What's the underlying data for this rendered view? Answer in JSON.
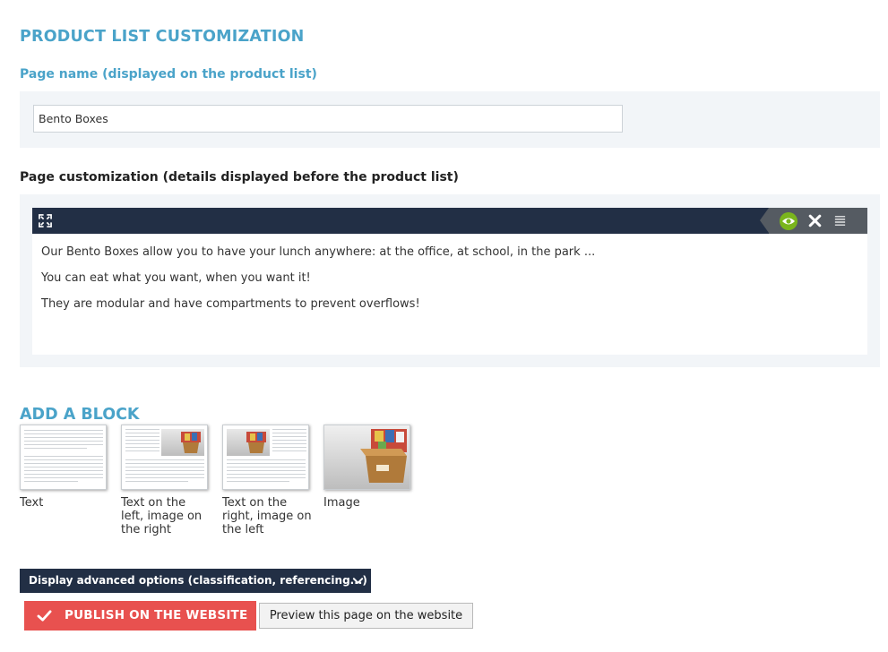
{
  "page": {
    "main_title": "PRODUCT LIST CUSTOMIZATION",
    "page_name_label": "Page name (displayed on the product list)",
    "page_name_value": "Bento Boxes",
    "customization_label": "Page customization (details displayed before the product list)"
  },
  "editor": {
    "toolbar_icons": [
      "expand-icon",
      "eye-icon",
      "close-icon",
      "menu-icon"
    ],
    "accent_color": "#7ab51d",
    "bar_color": "#222f45",
    "paragraphs": [
      "Our Bento Boxes allow you to have your lunch anywhere: at the office, at school, in the park ...",
      "You can eat what you want, when you want it!",
      "They are modular and have compartments to prevent overflows!"
    ]
  },
  "add_block": {
    "title": "ADD A BLOCK",
    "blocks": [
      {
        "label": "Text",
        "layout": "text"
      },
      {
        "label": "Text on the left, image on the right",
        "layout": "text-left-image-right"
      },
      {
        "label": "Text on the right, image on the left",
        "layout": "text-right-image-left"
      },
      {
        "label": "Image",
        "layout": "image"
      }
    ]
  },
  "actions": {
    "advanced_label": "Display advanced options (classification, referencing...)",
    "publish_label": "PUBLISH ON THE WEBSITE",
    "preview_label": "Preview this page on the website",
    "publish_color": "#e8514f"
  }
}
